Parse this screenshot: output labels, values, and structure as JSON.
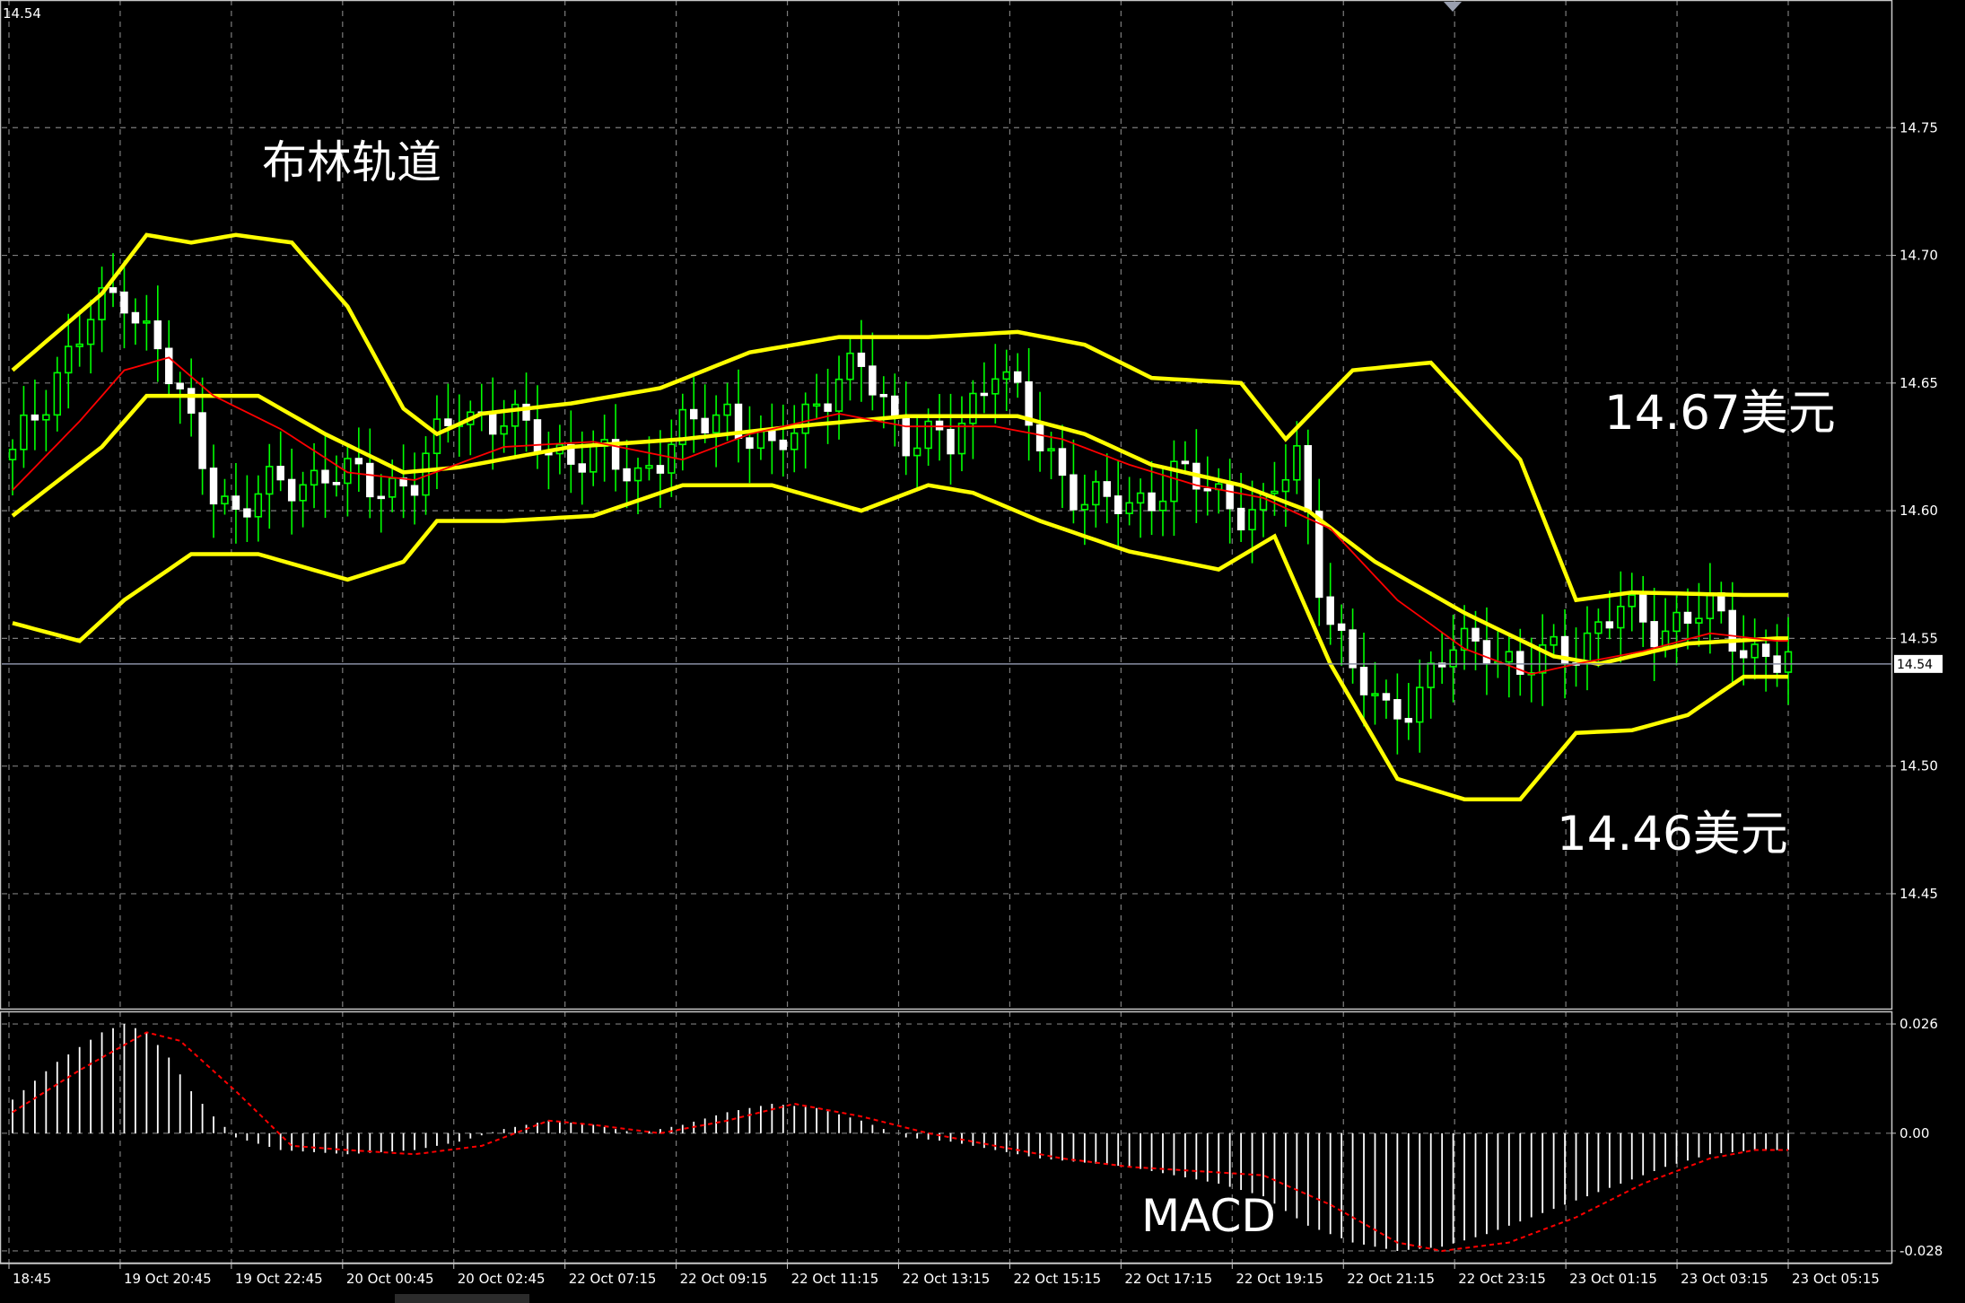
{
  "chart_data": [
    {
      "type": "candlestick",
      "title": "布林轨道",
      "y_ticks": [
        "14.75",
        "14.70",
        "14.65",
        "14.60",
        "14.55",
        "14.50",
        "14.45"
      ],
      "ylim": [
        14.405,
        14.8
      ],
      "current_price": "14.54",
      "corner_label": "14.54",
      "x_ticks": [
        "18:45",
        "19 Oct 20:45",
        "19 Oct 22:45",
        "20 Oct 00:45",
        "20 Oct 02:45",
        "22 Oct 07:15",
        "22 Oct 09:15",
        "22 Oct 11:15",
        "22 Oct 13:15",
        "22 Oct 15:15",
        "22 Oct 17:15",
        "22 Oct 19:15",
        "22 Oct 21:15",
        "22 Oct 23:15",
        "23 Oct 01:15",
        "23 Oct 03:15",
        "23 Oct 05:15"
      ],
      "annotations": [
        "14.67美元",
        "14.46美元"
      ],
      "bar_count": 160,
      "candle_color": "#00ff00",
      "band_color": "#ffff00",
      "ma_color": "#ff0000",
      "bollinger": {
        "upper": [
          [
            0,
            14.655
          ],
          [
            8,
            14.685
          ],
          [
            12,
            14.708
          ],
          [
            16,
            14.705
          ],
          [
            20,
            14.708
          ],
          [
            25,
            14.705
          ],
          [
            30,
            14.68
          ],
          [
            35,
            14.64
          ],
          [
            38,
            14.63
          ],
          [
            42,
            14.638
          ],
          [
            50,
            14.642
          ],
          [
            58,
            14.648
          ],
          [
            66,
            14.662
          ],
          [
            74,
            14.668
          ],
          [
            82,
            14.668
          ],
          [
            90,
            14.67
          ],
          [
            96,
            14.665
          ],
          [
            102,
            14.652
          ],
          [
            110,
            14.65
          ],
          [
            114,
            14.628
          ],
          [
            120,
            14.655
          ],
          [
            127,
            14.658
          ],
          [
            135,
            14.62
          ],
          [
            140,
            14.565
          ],
          [
            145,
            14.568
          ],
          [
            155,
            14.567
          ],
          [
            158,
            14.567
          ]
        ],
        "middle": [
          [
            0,
            14.598
          ],
          [
            8,
            14.625
          ],
          [
            12,
            14.645
          ],
          [
            16,
            14.645
          ],
          [
            22,
            14.645
          ],
          [
            28,
            14.63
          ],
          [
            35,
            14.615
          ],
          [
            40,
            14.617
          ],
          [
            50,
            14.625
          ],
          [
            60,
            14.628
          ],
          [
            70,
            14.633
          ],
          [
            80,
            14.637
          ],
          [
            90,
            14.637
          ],
          [
            96,
            14.63
          ],
          [
            102,
            14.618
          ],
          [
            110,
            14.61
          ],
          [
            116,
            14.6
          ],
          [
            122,
            14.58
          ],
          [
            130,
            14.56
          ],
          [
            138,
            14.543
          ],
          [
            142,
            14.54
          ],
          [
            150,
            14.548
          ],
          [
            158,
            14.55
          ]
        ],
        "lower": [
          [
            0,
            14.556
          ],
          [
            6,
            14.549
          ],
          [
            10,
            14.565
          ],
          [
            16,
            14.583
          ],
          [
            22,
            14.583
          ],
          [
            30,
            14.573
          ],
          [
            35,
            14.58
          ],
          [
            38,
            14.596
          ],
          [
            44,
            14.596
          ],
          [
            52,
            14.598
          ],
          [
            60,
            14.61
          ],
          [
            68,
            14.61
          ],
          [
            76,
            14.6
          ],
          [
            82,
            14.61
          ],
          [
            86,
            14.607
          ],
          [
            92,
            14.596
          ],
          [
            100,
            14.584
          ],
          [
            108,
            14.577
          ],
          [
            113,
            14.59
          ],
          [
            118,
            14.54
          ],
          [
            124,
            14.495
          ],
          [
            130,
            14.487
          ],
          [
            135,
            14.487
          ],
          [
            140,
            14.513
          ],
          [
            145,
            14.514
          ],
          [
            150,
            14.52
          ],
          [
            155,
            14.535
          ],
          [
            158,
            14.535
          ]
        ]
      },
      "moving_average": [
        [
          0,
          14.608
        ],
        [
          6,
          14.635
        ],
        [
          10,
          14.655
        ],
        [
          14,
          14.66
        ],
        [
          18,
          14.645
        ],
        [
          24,
          14.632
        ],
        [
          30,
          14.615
        ],
        [
          36,
          14.612
        ],
        [
          44,
          14.625
        ],
        [
          52,
          14.627
        ],
        [
          60,
          14.62
        ],
        [
          66,
          14.63
        ],
        [
          74,
          14.638
        ],
        [
          80,
          14.633
        ],
        [
          88,
          14.633
        ],
        [
          94,
          14.628
        ],
        [
          100,
          14.618
        ],
        [
          106,
          14.61
        ],
        [
          112,
          14.605
        ],
        [
          118,
          14.593
        ],
        [
          124,
          14.565
        ],
        [
          130,
          14.546
        ],
        [
          136,
          14.536
        ],
        [
          140,
          14.54
        ],
        [
          146,
          14.545
        ],
        [
          152,
          14.552
        ],
        [
          158,
          14.549
        ]
      ],
      "close_path": [
        [
          0,
          14.62
        ],
        [
          4,
          14.655
        ],
        [
          7,
          14.675
        ],
        [
          10,
          14.685
        ],
        [
          13,
          14.665
        ],
        [
          16,
          14.63
        ],
        [
          18,
          14.61
        ],
        [
          20,
          14.6
        ],
        [
          24,
          14.61
        ],
        [
          28,
          14.615
        ],
        [
          32,
          14.61
        ],
        [
          36,
          14.612
        ],
        [
          40,
          14.64
        ],
        [
          44,
          14.635
        ],
        [
          48,
          14.625
        ],
        [
          52,
          14.62
        ],
        [
          56,
          14.615
        ],
        [
          60,
          14.63
        ],
        [
          64,
          14.64
        ],
        [
          68,
          14.62
        ],
        [
          72,
          14.645
        ],
        [
          76,
          14.655
        ],
        [
          80,
          14.63
        ],
        [
          84,
          14.625
        ],
        [
          88,
          14.66
        ],
        [
          92,
          14.625
        ],
        [
          96,
          14.605
        ],
        [
          100,
          14.6
        ],
        [
          104,
          14.615
        ],
        [
          108,
          14.605
        ],
        [
          112,
          14.6
        ],
        [
          115,
          14.62
        ],
        [
          117,
          14.575
        ],
        [
          120,
          14.535
        ],
        [
          123,
          14.52
        ],
        [
          126,
          14.53
        ],
        [
          129,
          14.545
        ],
        [
          132,
          14.55
        ],
        [
          135,
          14.535
        ],
        [
          138,
          14.545
        ],
        [
          141,
          14.55
        ],
        [
          144,
          14.56
        ],
        [
          148,
          14.555
        ],
        [
          152,
          14.56
        ],
        [
          156,
          14.545
        ],
        [
          158,
          14.54
        ]
      ]
    },
    {
      "type": "bar",
      "title": "MACD",
      "y_ticks": [
        "0.026",
        "0.00",
        "-0.028"
      ],
      "ylim": [
        -0.031,
        0.029
      ],
      "histogram_color": "#ffffff",
      "signal_color": "#ff0000",
      "histogram": [
        [
          0,
          0.008
        ],
        [
          4,
          0.017
        ],
        [
          8,
          0.024
        ],
        [
          10,
          0.026
        ],
        [
          12,
          0.024
        ],
        [
          14,
          0.018
        ],
        [
          16,
          0.01
        ],
        [
          18,
          0.004
        ],
        [
          20,
          -0.001
        ],
        [
          24,
          -0.004
        ],
        [
          30,
          -0.005
        ],
        [
          36,
          -0.004
        ],
        [
          40,
          -0.002
        ],
        [
          44,
          0.001
        ],
        [
          48,
          0.003
        ],
        [
          52,
          0.002
        ],
        [
          56,
          0.0
        ],
        [
          60,
          0.002
        ],
        [
          64,
          0.005
        ],
        [
          68,
          0.007
        ],
        [
          72,
          0.006
        ],
        [
          76,
          0.003
        ],
        [
          80,
          -0.001
        ],
        [
          84,
          -0.002
        ],
        [
          88,
          -0.004
        ],
        [
          92,
          -0.006
        ],
        [
          96,
          -0.007
        ],
        [
          100,
          -0.008
        ],
        [
          104,
          -0.01
        ],
        [
          108,
          -0.012
        ],
        [
          112,
          -0.015
        ],
        [
          116,
          -0.022
        ],
        [
          120,
          -0.026
        ],
        [
          124,
          -0.028
        ],
        [
          128,
          -0.027
        ],
        [
          132,
          -0.024
        ],
        [
          136,
          -0.02
        ],
        [
          140,
          -0.016
        ],
        [
          144,
          -0.012
        ],
        [
          148,
          -0.008
        ],
        [
          152,
          -0.005
        ],
        [
          156,
          -0.004
        ],
        [
          158,
          -0.004
        ]
      ],
      "signal": [
        [
          0,
          0.005
        ],
        [
          6,
          0.015
        ],
        [
          12,
          0.024
        ],
        [
          15,
          0.022
        ],
        [
          20,
          0.01
        ],
        [
          25,
          -0.003
        ],
        [
          30,
          -0.004
        ],
        [
          36,
          -0.005
        ],
        [
          42,
          -0.003
        ],
        [
          48,
          0.003
        ],
        [
          52,
          0.002
        ],
        [
          58,
          0.0
        ],
        [
          64,
          0.003
        ],
        [
          70,
          0.007
        ],
        [
          76,
          0.004
        ],
        [
          82,
          0.0
        ],
        [
          88,
          -0.003
        ],
        [
          94,
          -0.006
        ],
        [
          100,
          -0.008
        ],
        [
          106,
          -0.009
        ],
        [
          112,
          -0.01
        ],
        [
          118,
          -0.017
        ],
        [
          124,
          -0.026
        ],
        [
          128,
          -0.028
        ],
        [
          134,
          -0.026
        ],
        [
          140,
          -0.02
        ],
        [
          146,
          -0.012
        ],
        [
          152,
          -0.006
        ],
        [
          156,
          -0.004
        ],
        [
          158,
          -0.004
        ]
      ]
    }
  ]
}
